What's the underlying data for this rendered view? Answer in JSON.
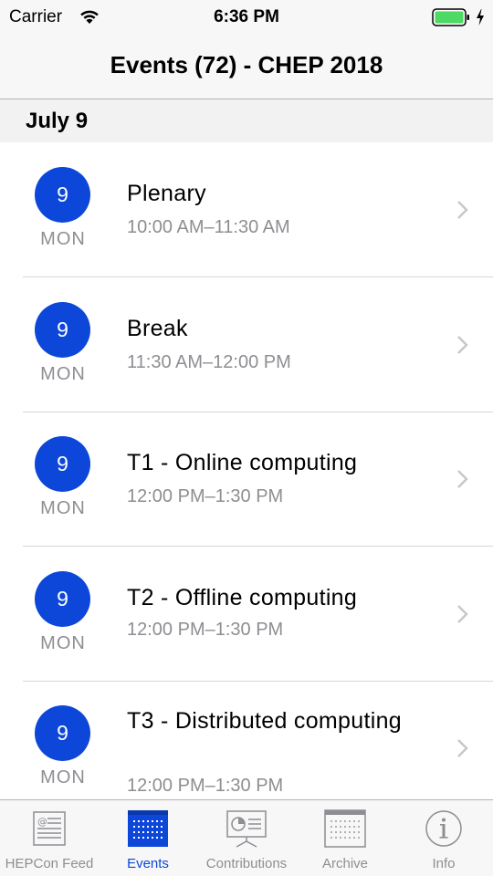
{
  "status_bar": {
    "carrier": "Carrier",
    "time": "6:36 PM",
    "icons": [
      "wifi-icon",
      "battery-icon",
      "charging-bolt-icon"
    ]
  },
  "nav": {
    "title": "Events (72) - CHEP 2018"
  },
  "section": {
    "title": "July 9"
  },
  "events": [
    {
      "day": "9",
      "weekday": "MON",
      "title": "Plenary",
      "time": "10:00 AM–11:30 AM"
    },
    {
      "day": "9",
      "weekday": "MON",
      "title": "Break",
      "time": "11:30 AM–12:00 PM"
    },
    {
      "day": "9",
      "weekday": "MON",
      "title": "T1 - Online computing",
      "time": "12:00 PM–1:30 PM"
    },
    {
      "day": "9",
      "weekday": "MON",
      "title": "T2 - Offline computing",
      "time": "12:00 PM–1:30 PM"
    },
    {
      "day": "9",
      "weekday": "MON",
      "title": "T3 - Distributed computing",
      "time": "12:00 PM–1:30 PM"
    }
  ],
  "tabs": [
    {
      "label": "HEPCon Feed",
      "icon": "feed-icon",
      "active": false
    },
    {
      "label": "Events",
      "icon": "calendar-grid-icon",
      "active": true
    },
    {
      "label": "Contributions",
      "icon": "presentation-icon",
      "active": false
    },
    {
      "label": "Archive",
      "icon": "archive-calendar-icon",
      "active": false
    },
    {
      "label": "Info",
      "icon": "info-icon",
      "active": false
    }
  ],
  "colors": {
    "accent": "#0c47d9",
    "secondary_text": "#8e8e93",
    "battery_green": "#4cd964"
  }
}
